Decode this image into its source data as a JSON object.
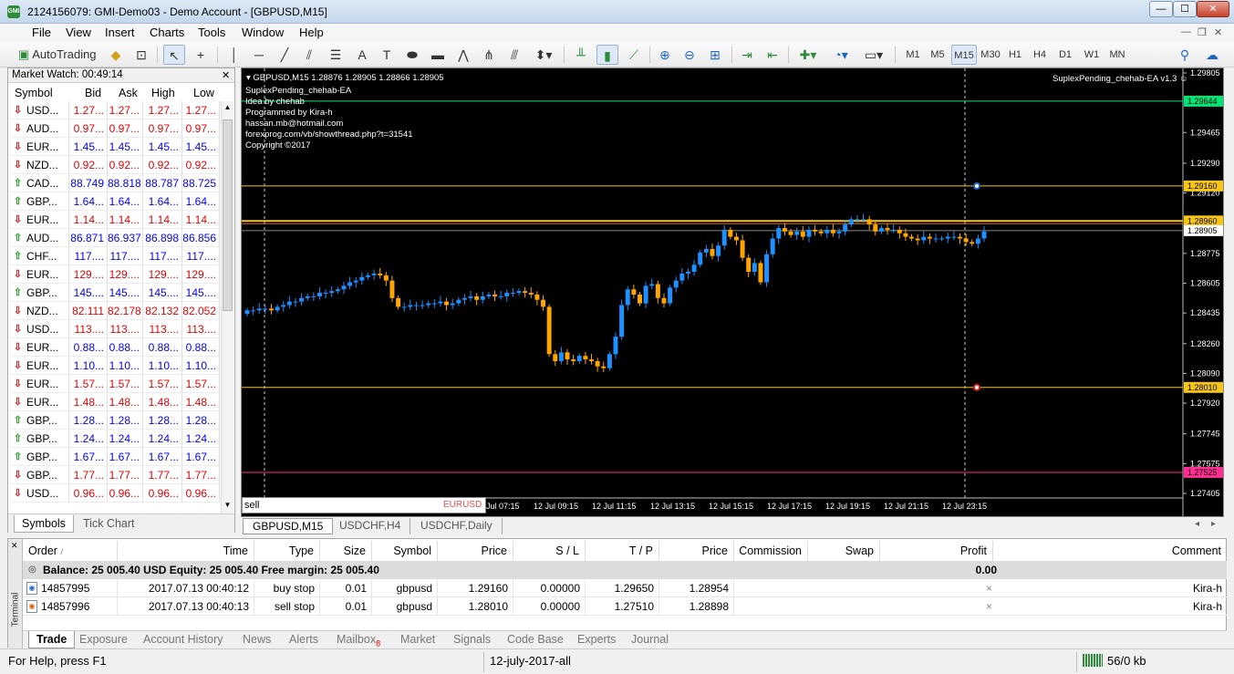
{
  "window": {
    "title": "2124156079: GMI-Demo03 - Demo Account - [GBPUSD,M15]",
    "app_icon": "GMI",
    "min": "—",
    "max": "☐",
    "close": "✕"
  },
  "menu": [
    "File",
    "View",
    "Insert",
    "Charts",
    "Tools",
    "Window",
    "Help"
  ],
  "toolbar": {
    "autotrading": "AutoTrading",
    "timeframes": [
      "M1",
      "M5",
      "M15",
      "M30",
      "H1",
      "H4",
      "D1",
      "W1",
      "MN"
    ],
    "active_tf": "M15"
  },
  "market_watch": {
    "title": "Market Watch: 00:49:14",
    "columns": [
      "Symbol",
      "Bid",
      "Ask",
      "High",
      "Low"
    ],
    "rows": [
      {
        "symbol": "USD...",
        "bid": "1.27...",
        "ask": "1.27...",
        "high": "1.27...",
        "low": "1.27...",
        "dir": "down",
        "color": "red"
      },
      {
        "symbol": "AUD...",
        "bid": "0.97...",
        "ask": "0.97...",
        "high": "0.97...",
        "low": "0.97...",
        "dir": "down",
        "color": "red"
      },
      {
        "symbol": "EUR...",
        "bid": "1.45...",
        "ask": "1.45...",
        "high": "1.45...",
        "low": "1.45...",
        "dir": "down",
        "color": "blue"
      },
      {
        "symbol": "NZD...",
        "bid": "0.92...",
        "ask": "0.92...",
        "high": "0.92...",
        "low": "0.92...",
        "dir": "down",
        "color": "red"
      },
      {
        "symbol": "CAD...",
        "bid": "88.749",
        "ask": "88.818",
        "high": "88.787",
        "low": "88.725",
        "dir": "up",
        "color": "blue"
      },
      {
        "symbol": "GBP...",
        "bid": "1.64...",
        "ask": "1.64...",
        "high": "1.64...",
        "low": "1.64...",
        "dir": "up",
        "color": "blue"
      },
      {
        "symbol": "EUR...",
        "bid": "1.14...",
        "ask": "1.14...",
        "high": "1.14...",
        "low": "1.14...",
        "dir": "down",
        "color": "red"
      },
      {
        "symbol": "AUD...",
        "bid": "86.871",
        "ask": "86.937",
        "high": "86.898",
        "low": "86.856",
        "dir": "up",
        "color": "blue"
      },
      {
        "symbol": "CHF...",
        "bid": "117....",
        "ask": "117....",
        "high": "117....",
        "low": "117....",
        "dir": "up",
        "color": "blue"
      },
      {
        "symbol": "EUR...",
        "bid": "129....",
        "ask": "129....",
        "high": "129....",
        "low": "129....",
        "dir": "down",
        "color": "red"
      },
      {
        "symbol": "GBP...",
        "bid": "145....",
        "ask": "145....",
        "high": "145....",
        "low": "145....",
        "dir": "up",
        "color": "blue"
      },
      {
        "symbol": "NZD...",
        "bid": "82.111",
        "ask": "82.178",
        "high": "82.132",
        "low": "82.052",
        "dir": "down",
        "color": "red"
      },
      {
        "symbol": "USD...",
        "bid": "113....",
        "ask": "113....",
        "high": "113....",
        "low": "113....",
        "dir": "down",
        "color": "red"
      },
      {
        "symbol": "EUR...",
        "bid": "0.88...",
        "ask": "0.88...",
        "high": "0.88...",
        "low": "0.88...",
        "dir": "down",
        "color": "blue"
      },
      {
        "symbol": "EUR...",
        "bid": "1.10...",
        "ask": "1.10...",
        "high": "1.10...",
        "low": "1.10...",
        "dir": "down",
        "color": "blue"
      },
      {
        "symbol": "EUR...",
        "bid": "1.57...",
        "ask": "1.57...",
        "high": "1.57...",
        "low": "1.57...",
        "dir": "down",
        "color": "red"
      },
      {
        "symbol": "EUR...",
        "bid": "1.48...",
        "ask": "1.48...",
        "high": "1.48...",
        "low": "1.48...",
        "dir": "down",
        "color": "red"
      },
      {
        "symbol": "GBP...",
        "bid": "1.28...",
        "ask": "1.28...",
        "high": "1.28...",
        "low": "1.28...",
        "dir": "up",
        "color": "blue"
      },
      {
        "symbol": "GBP...",
        "bid": "1.24...",
        "ask": "1.24...",
        "high": "1.24...",
        "low": "1.24...",
        "dir": "up",
        "color": "blue"
      },
      {
        "symbol": "GBP...",
        "bid": "1.67...",
        "ask": "1.67...",
        "high": "1.67...",
        "low": "1.67...",
        "dir": "up",
        "color": "blue"
      },
      {
        "symbol": "GBP...",
        "bid": "1.77...",
        "ask": "1.77...",
        "high": "1.77...",
        "low": "1.77...",
        "dir": "down",
        "color": "red"
      },
      {
        "symbol": "USD...",
        "bid": "0.96...",
        "ask": "0.96...",
        "high": "0.96...",
        "low": "0.96...",
        "dir": "down",
        "color": "red"
      }
    ],
    "tabs": [
      "Symbols",
      "Tick Chart"
    ]
  },
  "chart": {
    "header": "GBPUSD,M15  1.28876 1.28905 1.28866 1.28905",
    "ea_label": "SuplexPending_chehab-EA v1.3 ☺",
    "info": [
      "SuplexPending_chehab-EA",
      "Idea by chehab",
      "Programmed by Kira-h",
      "hassan.mb@hotmail.com",
      "forexprog.com/vb/showthread.php?t=31541",
      "Copyright ©2017"
    ],
    "price_labels": [
      "1.29805",
      "1.29465",
      "1.29290",
      "1.29120",
      "1.28775",
      "1.28605",
      "1.28435",
      "1.28260",
      "1.28090",
      "1.27920",
      "1.27745",
      "1.27575",
      "1.27405"
    ],
    "level_labels": [
      {
        "text": "1.29644",
        "color": "#00e676"
      },
      {
        "text": "1.29160",
        "color": "#f5c518"
      },
      {
        "text": "1.28960",
        "color": "#f5c518"
      },
      {
        "text": "1.28905",
        "color": "#ffffff"
      },
      {
        "text": "1.28010",
        "color": "#f5c518"
      },
      {
        "text": "1.27525",
        "color": "#ff2e92"
      }
    ],
    "time_labels": [
      "Jul 07:15",
      "12 Jul 09:15",
      "12 Jul 11:15",
      "12 Jul 13:15",
      "12 Jul 15:15",
      "12 Jul 17:15",
      "12 Jul 19:15",
      "12 Jul 21:15",
      "12 Jul 23:15"
    ],
    "command_input": "sell",
    "command_hint": "EURUSD",
    "colors": {
      "bull": "#1e90ff",
      "bear": "#ffa500",
      "bg": "#000000"
    }
  },
  "chart_tabs": [
    "GBPUSD,M15",
    "USDCHF,H4",
    "USDCHF,Daily"
  ],
  "terminal": {
    "label": "Terminal",
    "columns": [
      "Order",
      "Time",
      "Type",
      "Size",
      "Symbol",
      "Price",
      "S / L",
      "T / P",
      "Price",
      "Commission",
      "Swap",
      "Profit",
      "Comment"
    ],
    "sort_mark": "/",
    "balance": "Balance: 25 005.40 USD  Equity: 25 005.40  Free margin: 25 005.40",
    "balance_profit": "0.00",
    "orders": [
      {
        "order": "14857995",
        "time": "2017.07.13 00:40:12",
        "type": "buy stop",
        "size": "0.01",
        "symbol": "gbpusd",
        "price": "1.29160",
        "sl": "0.00000",
        "tp": "1.29650",
        "cur": "1.28954",
        "close": "×",
        "comment": "Kira-h"
      },
      {
        "order": "14857996",
        "time": "2017.07.13 00:40:13",
        "type": "sell stop",
        "size": "0.01",
        "symbol": "gbpusd",
        "price": "1.28010",
        "sl": "0.00000",
        "tp": "1.27510",
        "cur": "1.28898",
        "close": "×",
        "comment": "Kira-h"
      }
    ],
    "tabs": [
      "Trade",
      "Exposure",
      "Account History",
      "News",
      "Alerts",
      "Mailbox",
      "Market",
      "Signals",
      "Code Base",
      "Experts",
      "Journal"
    ],
    "mailbox_badge": "8"
  },
  "status": {
    "help": "For Help, press F1",
    "profile": "12-july-2017-all",
    "traffic": "56/0 kb"
  }
}
